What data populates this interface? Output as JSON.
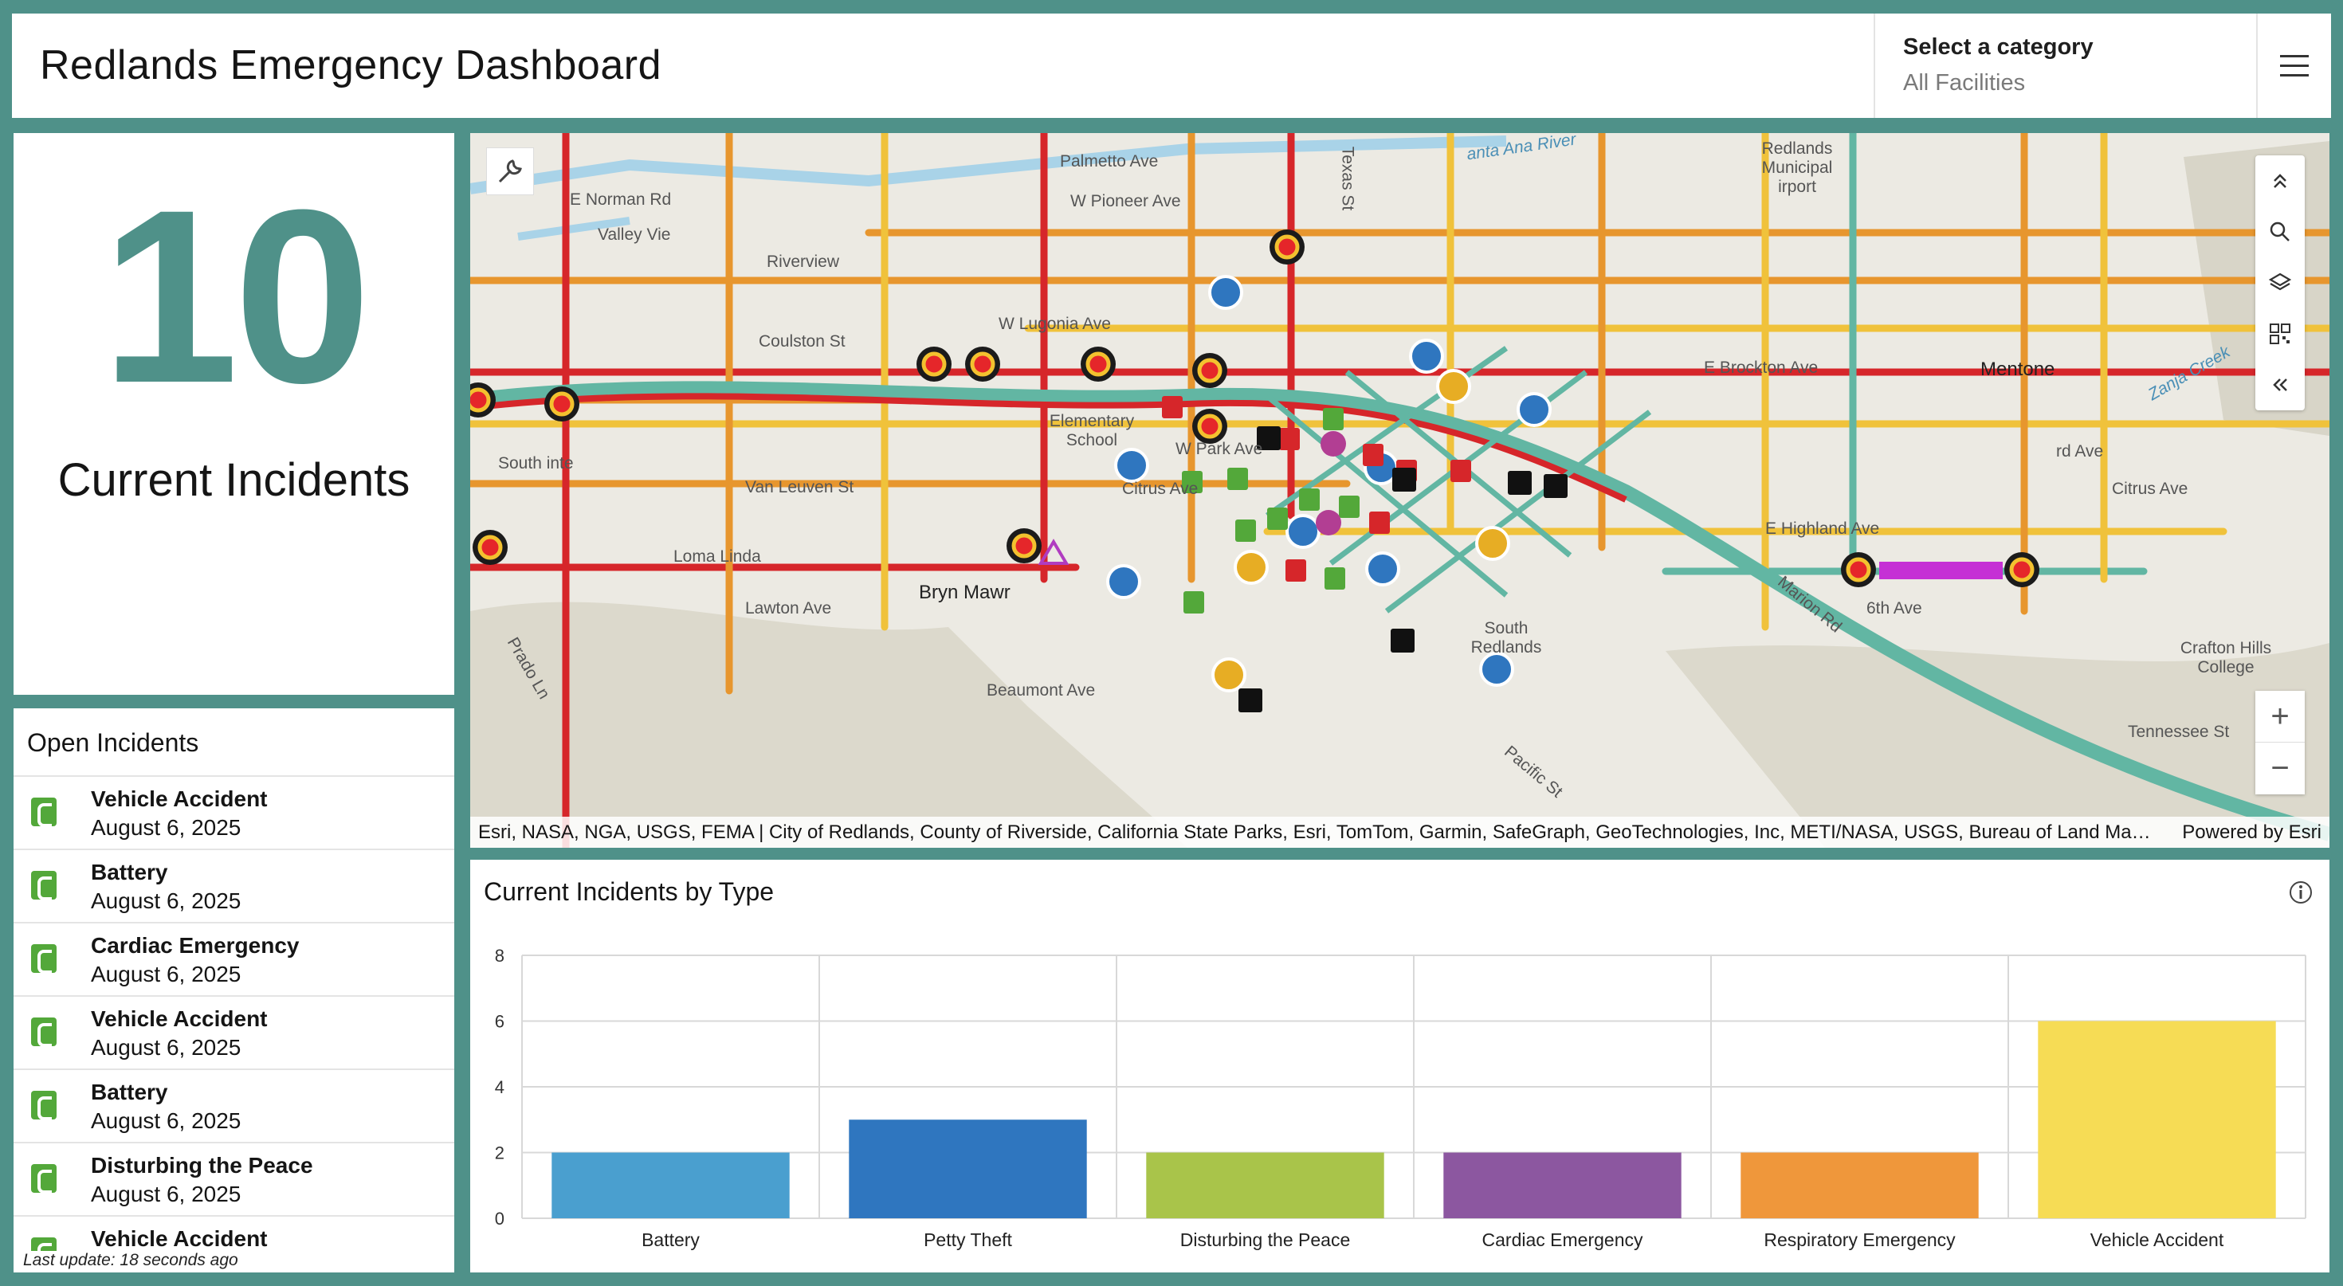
{
  "header": {
    "title": "Redlands Emergency Dashboard",
    "category_label": "Select a category",
    "category_value": "All Facilities",
    "menu_icon": "hamburger-menu-icon"
  },
  "indicator": {
    "value": "10",
    "label": "Current Incidents"
  },
  "open_incidents": {
    "title": "Open Incidents",
    "items": [
      {
        "type": "Vehicle Accident",
        "date": "August 6, 2025"
      },
      {
        "type": "Battery",
        "date": "August 6, 2025"
      },
      {
        "type": "Cardiac Emergency",
        "date": "August 6, 2025"
      },
      {
        "type": "Vehicle Accident",
        "date": "August 6, 2025"
      },
      {
        "type": "Battery",
        "date": "August 6, 2025"
      },
      {
        "type": "Disturbing the Peace",
        "date": "August 6, 2025"
      },
      {
        "type": "Vehicle Accident",
        "date": ""
      }
    ],
    "last_update": "Last update: 18 seconds ago"
  },
  "map": {
    "places": {
      "palmetto": "Palmetto Ave",
      "pioneer": "W Pioneer Ave",
      "norman": "E Norman Rd",
      "valley": "Valley Vie",
      "riverview": "Riverview",
      "lugonia": "W Lugonia Ave",
      "coulston": "Coulston St",
      "brockton": "E Brockton Ave",
      "mentone": "Mentone",
      "elementary": "Elementary School",
      "park": "W Park Ave",
      "citrus": "Citrus Ave",
      "citrus_e": "Citrus Ave",
      "vanleuven": "Van Leuven St",
      "southpointe": "South  inte",
      "lawton": "Lawton Ave",
      "brynmawr": "Bryn Mawr",
      "beaumont": "Beaumont Ave",
      "southredlands": "South Redlands",
      "highland": "E Highland Ave",
      "sixth": "6th Ave",
      "marion": "Marion Rd",
      "crafton": "Crafton Hills College",
      "tennessee": "Tennessee St",
      "santaana": "anta Ana River",
      "municipal": "Redlands Municipal  irport",
      "zanja": "Zanja Creek",
      "texas": "Texas St",
      "pacific": "Pacific St",
      "prado": "Prado Ln",
      "ward": "rd Ave",
      "lomalinda": "Loma Linda"
    },
    "attribution": "Esri, NASA, NGA, USGS, FEMA | City of Redlands, County of Riverside, California State Parks, Esri, TomTom, Garmin, SafeGraph, GeoTechnologies, Inc, METI/NASA, USGS, Bureau of Land Manage…",
    "powered_by": "Powered by Esri"
  },
  "chart_title": "Current Incidents by Type",
  "chart_data": {
    "type": "bar",
    "title": "Current Incidents by Type",
    "categories": [
      "Battery",
      "Petty Theft",
      "Disturbing the Peace",
      "Cardiac Emergency",
      "Respiratory Emergency",
      "Vehicle Accident"
    ],
    "values": [
      2,
      3,
      2,
      2,
      2,
      6
    ],
    "colors": [
      "#4a9fcf",
      "#2f76bf",
      "#a9c44a",
      "#8c57a0",
      "#ef973b",
      "#f6dc55"
    ],
    "ylim": [
      0,
      8
    ],
    "yticks": [
      0,
      2,
      4,
      6,
      8
    ],
    "grid": true,
    "xlabel": "",
    "ylabel": ""
  }
}
